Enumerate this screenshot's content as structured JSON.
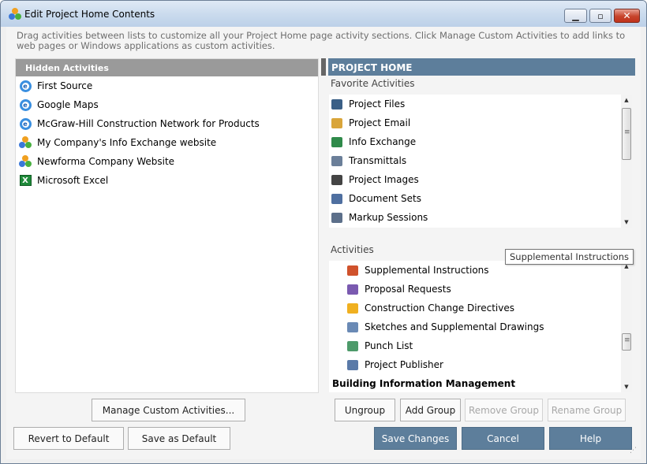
{
  "window": {
    "title": "Edit Project Home Contents"
  },
  "instructions": "Drag activities between lists to customize all your Project Home page activity sections.  Click Manage Custom Activities to add links to web pages or Windows applications as custom activities.",
  "hidden": {
    "header": "Hidden Activities",
    "items": [
      {
        "label": "First Source",
        "icon": "internet-explorer-icon"
      },
      {
        "label": "Google Maps",
        "icon": "internet-explorer-icon"
      },
      {
        "label": "McGraw-Hill Construction Network for Products",
        "icon": "internet-explorer-icon"
      },
      {
        "label": "My Company's Info Exchange website",
        "icon": "newforma-logo-icon"
      },
      {
        "label": "Newforma Company Website",
        "icon": "newforma-logo-icon"
      },
      {
        "label": "Microsoft Excel",
        "icon": "excel-icon"
      }
    ]
  },
  "project_home": {
    "header": "PROJECT HOME",
    "favorites_label": "Favorite Activities",
    "favorites": [
      {
        "label": "Project Files",
        "icon": "folder-icon"
      },
      {
        "label": "Project Email",
        "icon": "email-icon"
      },
      {
        "label": "Info Exchange",
        "icon": "satellite-icon"
      },
      {
        "label": "Transmittals",
        "icon": "transmittal-icon"
      },
      {
        "label": "Project Images",
        "icon": "camera-icon"
      },
      {
        "label": "Document Sets",
        "icon": "document-sets-icon"
      },
      {
        "label": "Markup Sessions",
        "icon": "markup-icon"
      }
    ],
    "activities_label": "Activities",
    "activities": [
      {
        "label": "Supplemental Instructions",
        "icon": "supplemental-instructions-icon"
      },
      {
        "label": "Proposal Requests",
        "icon": "proposal-requests-icon"
      },
      {
        "label": "Construction Change Directives",
        "icon": "hard-hat-icon"
      },
      {
        "label": "Sketches and Supplemental Drawings",
        "icon": "sketches-icon"
      },
      {
        "label": "Punch List",
        "icon": "punch-list-icon"
      },
      {
        "label": "Project Publisher",
        "icon": "publisher-icon"
      }
    ],
    "group_heading": "Building Information Management"
  },
  "tooltip": "Supplemental Instructions",
  "buttons": {
    "manage_custom": "Manage Custom Activities...",
    "ungroup": "Ungroup",
    "add_group": "Add Group",
    "remove_group": "Remove Group",
    "rename_group": "Rename Group",
    "revert": "Revert to Default",
    "save_default": "Save as Default",
    "save_changes": "Save Changes",
    "cancel": "Cancel",
    "help": "Help"
  },
  "colors": {
    "accent": "#5d7e9b",
    "hidden_header": "#9a9a9a"
  }
}
